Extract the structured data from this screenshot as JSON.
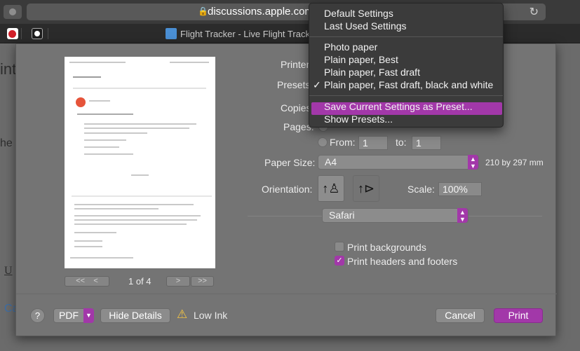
{
  "browser": {
    "url": "discussions.apple.com/thr",
    "tab_title": "Flight Tracker - Live Flight Tracking"
  },
  "underpage": {
    "snippet_1": "int",
    "snippet_2": "he",
    "snippet_3": "U",
    "snippet_4": "Ca"
  },
  "preview": {
    "page_indicator": "1 of 4",
    "first_page_label": "<<",
    "prev_page_label": "<",
    "next_page_label": ">",
    "last_page_label": ">>"
  },
  "print_dialog": {
    "printer_label": "Printer",
    "presets_label": "Presets",
    "copies_label": "Copies",
    "pages_label": "Pages:",
    "from_label": "From:",
    "from_value": "1",
    "to_label": "to:",
    "to_value": "1",
    "paper_size_label": "Paper Size:",
    "paper_size_value": "A4",
    "paper_size_dimensions": "210 by 297 mm",
    "orientation_label": "Orientation:",
    "scale_label": "Scale:",
    "scale_value": "100%",
    "app_section_value": "Safari",
    "print_backgrounds_label": "Print backgrounds",
    "print_backgrounds_checked": false,
    "print_headers_footers_label": "Print headers and footers",
    "print_headers_footers_checked": true,
    "help_label": "?",
    "pdf_label": "PDF",
    "hide_details_label": "Hide Details",
    "low_ink_label": "Low Ink",
    "cancel_label": "Cancel",
    "print_label": "Print"
  },
  "presets_menu": {
    "items": [
      {
        "label": "Default Settings"
      },
      {
        "label": "Last Used Settings"
      },
      {
        "label": "Photo paper"
      },
      {
        "label": "Plain paper, Best"
      },
      {
        "label": "Plain paper, Fast draft"
      },
      {
        "label": "Plain paper, Fast draft, black and white",
        "checked": true
      },
      {
        "label": "Save Current Settings as Preset...",
        "highlighted": true
      },
      {
        "label": "Show Presets..."
      }
    ]
  },
  "colors": {
    "accent": "#a238a9",
    "dialog_bg": "#747474",
    "menu_bg": "#3b3b3b"
  }
}
